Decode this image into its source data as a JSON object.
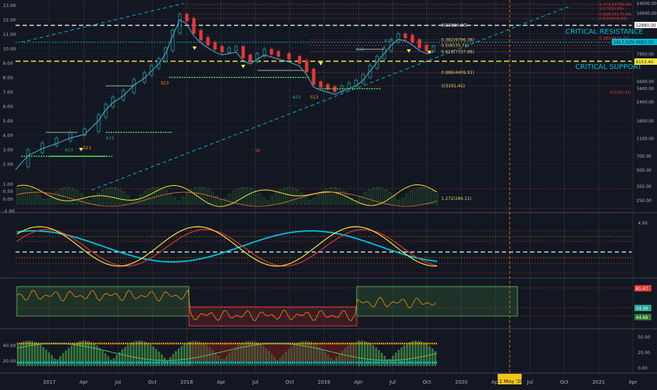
{
  "colors": {
    "bg": "#131722",
    "grid": "#2a2e39",
    "vgrid": "#36503a",
    "up": "#26a69a",
    "down": "#e53935",
    "white_dash": "#e6e6e6",
    "yellow": "#ffeb3b",
    "cyan": "#00bcd4",
    "red_dot": "#e53935",
    "green_dot": "#4caf50",
    "orange": "#ff9800",
    "axis_text": "#b2b5be",
    "fib_text": "#e6d36b",
    "crosshair": "#ff9800"
  },
  "chart_data": [
    {
      "type": "candlestick",
      "name": "price",
      "scale": "log",
      "y_left_ticks": [
        "13.00",
        "12.00",
        "11.00",
        "10.00",
        "9.00",
        "8.00",
        "7.00",
        "6.00",
        "5.00",
        "4.00",
        "3.00",
        "2.00"
      ],
      "y_right_ticks": [
        "24000.00",
        "16000.00",
        "11600.00",
        "7900.00",
        "5600.00",
        "3400.00",
        "2400.00",
        "1600.00",
        "1100.00",
        "700.00",
        "500.00",
        "350.00",
        "250.00"
      ],
      "levels": [
        {
          "label": "0(13880.00)",
          "value": 13880
        },
        {
          "label": "0.382(9796.36)",
          "value": 9796.36
        },
        {
          "label": "0.5(8535.71)",
          "value": 8535.71
        },
        {
          "label": "0.618(7337.86)",
          "value": 7337.86
        },
        {
          "label": "0.886(4409.91)",
          "value": 4409.91
        },
        {
          "label": "1(3191.41)",
          "value": 3191.41
        },
        {
          "label": "1.272(284.11)",
          "value": 284.11
        }
      ],
      "right_levels": [
        "1.272(19750.00)",
        "1(17630.00)",
        "0.886(16175.00)",
        "0.5(10616.00)",
        "0.382(9424.70)",
        "0(3191.41)"
      ],
      "annotations": {
        "critical_resistance": "CRITICAL RESISTANCE",
        "critical_support": "CRITICAL SUPPORT",
        "price_tag_1": "12880.00",
        "price_tag_2": "1417.02%",
        "price_tag_3": "9693.30",
        "price_tag_4": "6153.40",
        "w_marker": "W",
        "labels": [
          "A13",
          "S13",
          "A13",
          "S13",
          "A13",
          "S13",
          "A13",
          "A13"
        ]
      }
    },
    {
      "type": "line",
      "name": "oscillator",
      "y_ticks": [
        "1.00",
        "0.50",
        "0.00",
        "-1.00"
      ],
      "right_ticks": [
        "350.00",
        "250.00"
      ]
    },
    {
      "type": "line",
      "name": "stochastic",
      "right_ticks": [
        "4.00"
      ]
    },
    {
      "type": "line",
      "name": "rsi",
      "right_values": [
        "81.47",
        "54.36",
        "44.68"
      ]
    },
    {
      "type": "area",
      "name": "volume_momentum",
      "y_ticks": [
        "40.00",
        "20.00"
      ],
      "right_ticks": [
        "50.00",
        "25.00",
        "0.00"
      ]
    }
  ],
  "x_axis": {
    "labels": [
      "2017",
      "Apr",
      "Jul",
      "Oct",
      "2018",
      "Apr",
      "Jul",
      "Oct",
      "2019",
      "Apr",
      "Jul",
      "Oct",
      "2020",
      "Apr",
      "Jul",
      "Oct",
      "2021",
      "Apr"
    ],
    "crosshair_label": "11 May '20"
  }
}
